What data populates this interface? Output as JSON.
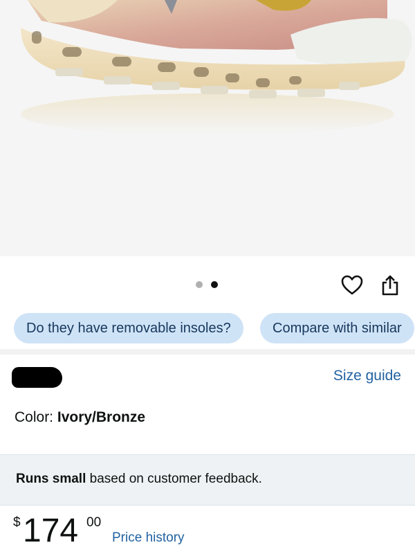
{
  "product_image": {
    "alt": "Ivory/Bronze trail running shoe"
  },
  "carousel": {
    "count": 2,
    "active_index": 1
  },
  "actions": {
    "wishlist_icon": "heart-icon",
    "share_icon": "share-icon"
  },
  "questions": [
    {
      "label": "Do they have removable insoles?"
    },
    {
      "label": "Compare with similar"
    }
  ],
  "size": {
    "guide_label": "Size guide"
  },
  "color": {
    "label": "Color: ",
    "value": "Ivory/Bronze"
  },
  "fit": {
    "strong": "Runs small",
    "rest": " based on customer feedback."
  },
  "price": {
    "currency": "$",
    "whole": "174",
    "fraction": "00",
    "history_label": "Price history"
  },
  "colors": {
    "link": "#2162a1",
    "chip_bg": "#cfe3f7",
    "fit_bg": "#eef2f4"
  }
}
